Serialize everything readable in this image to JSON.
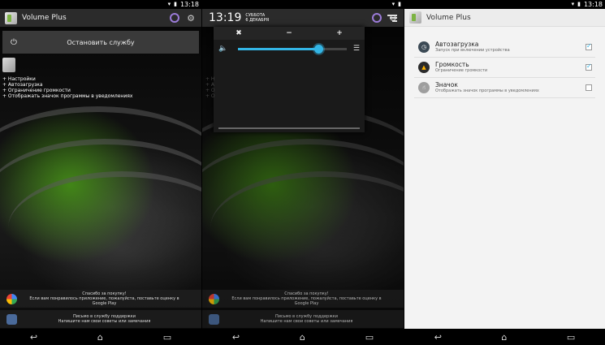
{
  "status": {
    "time": "13:18"
  },
  "app": {
    "title": "Volume Plus"
  },
  "main": {
    "stop_service": "Остановить службу",
    "features": [
      "+ Настройки",
      "+ Автозагрузка",
      "+ Ограничение громкости",
      "+ Отображать значок программы в уведомлениях"
    ]
  },
  "promo": {
    "rate_line1": "Спасибо за покупку!",
    "rate_line2": "Если вам понравилось приложение, пожалуйста, поставьте оценку в Google Play",
    "support_line1": "Письмо в службу поддержки",
    "support_line2": "Напишите нам свои советы или замечания"
  },
  "notification_shade": {
    "time": "13:19",
    "day": "СУББОТА",
    "date": "6 ДЕКАБРЯ",
    "volume_level": 0.74
  },
  "settings": {
    "items": [
      {
        "title": "Автозагрузка",
        "subtitle": "Запуск при включении устройства",
        "checked": true,
        "icon_color": "#3c4a55"
      },
      {
        "title": "Громкость",
        "subtitle": "Ограничение громкости",
        "checked": true,
        "icon_color": "#2b2b2b"
      },
      {
        "title": "Значок",
        "subtitle": "Отображать значок программы в уведомлениях",
        "checked": false,
        "icon_color": "#9e9e9e"
      }
    ]
  },
  "colors": {
    "accent": "#33b5e5",
    "ring": "#9b7bd8"
  }
}
